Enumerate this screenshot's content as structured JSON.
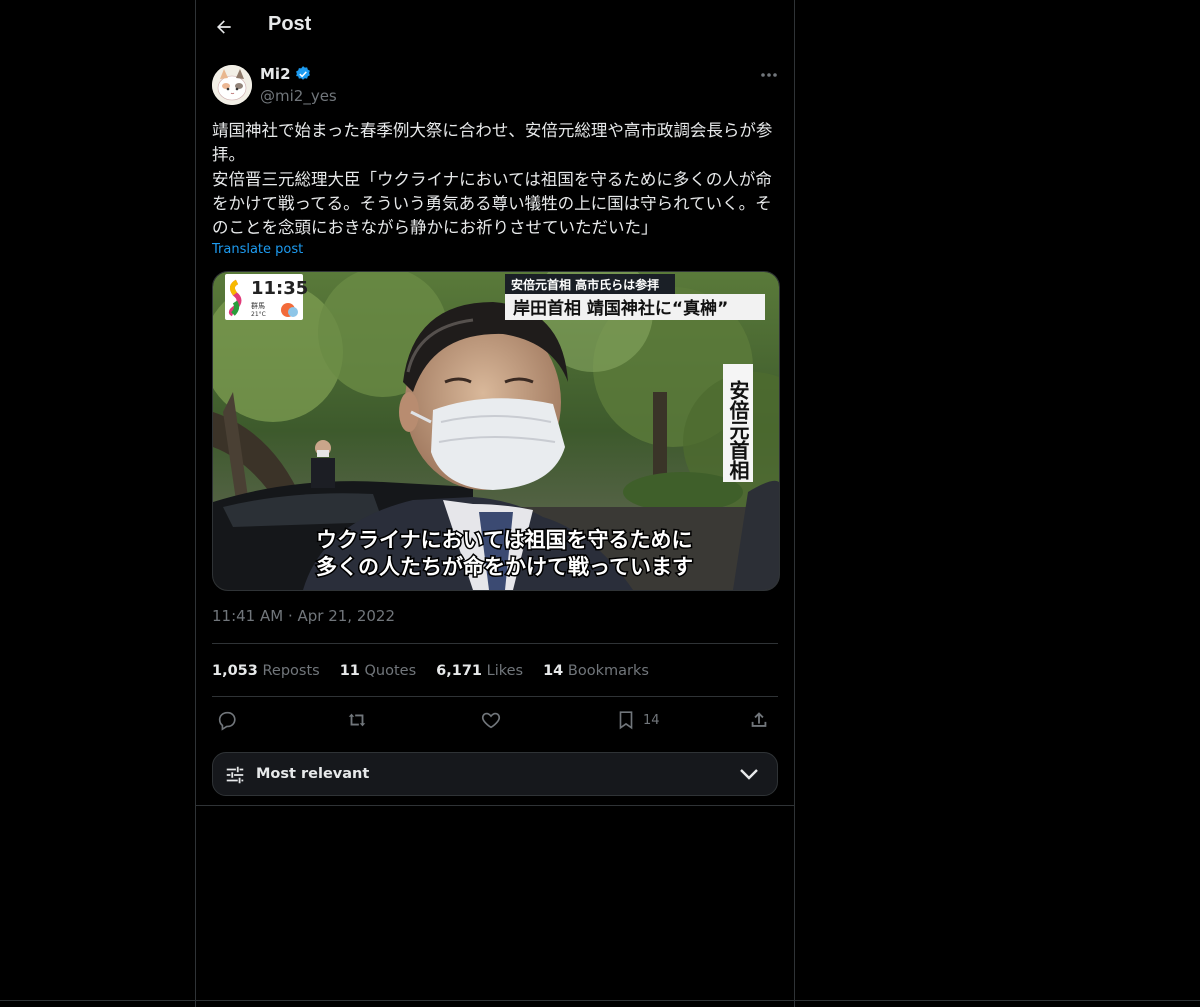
{
  "header": {
    "title": "Post"
  },
  "author": {
    "name": "Mi2",
    "handle": "@mi2_yes"
  },
  "post": {
    "text": "靖国神社で始まった春季例大祭に合わせ、安倍元総理や高市政調会長らが参拝。\n安倍晋三元総理大臣「ウクライナにおいては祖国を守るために多くの人が命をかけて戦ってる。そういう勇気ある尊い犠牲の上に国は守られていく。そのことを念頭におきながら静かにお祈りさせていただいた」",
    "translate_label": "Translate post",
    "timestamp": "11:41 AM · Apr 21, 2022"
  },
  "media": {
    "clock": "11:35",
    "weather_region": "群馬",
    "weather_temp": "21°C",
    "headline_small": "安倍元首相 高市氏らは参拝",
    "headline_main": "岸田首相 靖国神社に“真榊”",
    "name_caption": "安倍元首相",
    "subtitle_line1": "ウクライナにおいては祖国を守るために",
    "subtitle_line2": "多くの人たちが命をかけて戦っています"
  },
  "stats": [
    {
      "number": "1,053",
      "label": "Reposts"
    },
    {
      "number": "11",
      "label": "Quotes"
    },
    {
      "number": "6,171",
      "label": "Likes"
    },
    {
      "number": "14",
      "label": "Bookmarks"
    }
  ],
  "actions": {
    "reply_icon": "reply-icon",
    "repost_icon": "repost-icon",
    "like_icon": "heart-icon",
    "bookmark_icon": "bookmark-icon",
    "bookmark_count": "14",
    "share_icon": "share-icon"
  },
  "sort": {
    "label": "Most relevant"
  },
  "colors": {
    "accent": "#1d9bf0",
    "background": "#000000",
    "border": "#2f3336",
    "muted": "#71767b"
  }
}
